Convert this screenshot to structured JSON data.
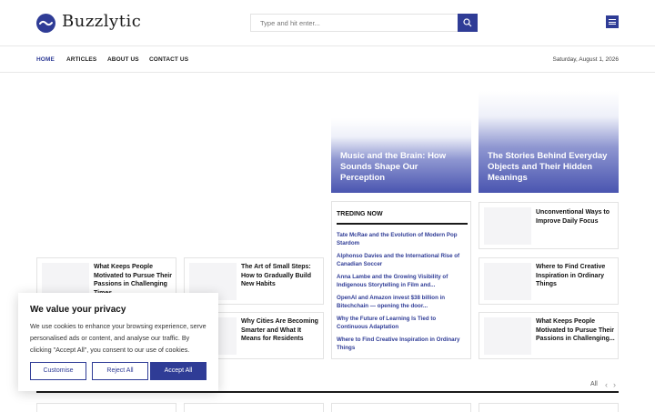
{
  "header": {
    "logo_text": "Buzzlytic",
    "search_placeholder": "Type and hit enter..."
  },
  "nav": {
    "items": [
      "HOME",
      "ARTICLES",
      "ABOUT US",
      "CONTACT US"
    ],
    "date": "Saturday, August 1, 2026"
  },
  "hero": [
    {
      "title": "Music and the Brain: How Sounds Shape Our Perception"
    },
    {
      "title": "The Stories Behind Everyday Objects and Their Hidden Meanings"
    }
  ],
  "trending": {
    "heading": "TREDING NOW",
    "items": [
      "Tate McRae and the Evolution of Modern Pop Stardom",
      "Alphonso Davies and the International Rise of Canadian Soccer",
      "Anna Lambe and the Growing Visibility of Indigenous Storytelling in Film and...",
      "OpenAI and Amazon invest $38 billion in Bitechchain — opening the door...",
      "Why the Future of Learning Is Tied to Continuous Adaptation",
      "Where to Find Creative Inspiration in Ordinary Things"
    ]
  },
  "cards": {
    "left_col": [
      "What Keeps People Motivated to Pursue Their Passions in Challenging Times"
    ],
    "mid_col": [
      "The Art of Small Steps: How to Gradually Build New Habits",
      "Why Cities Are Becoming Smarter and What It Means for Residents"
    ],
    "right_col": [
      "Unconventional Ways to Improve Daily Focus",
      "Where to Find Creative Inspiration in Ordinary Things",
      "What Keeps People Motivated to Pursue Their Passions in Challenging..."
    ]
  },
  "cookie": {
    "title": "We value your privacy",
    "text": "We use cookies to enhance your browsing experience, serve personalised ads or content, and analyse our traffic. By clicking \"Accept All\", you consent to our use of cookies.",
    "customise": "Customise",
    "reject": "Reject All",
    "accept": "Accept All"
  },
  "section": {
    "all_label": "All"
  },
  "colors": {
    "brand": "#2f3c96"
  }
}
